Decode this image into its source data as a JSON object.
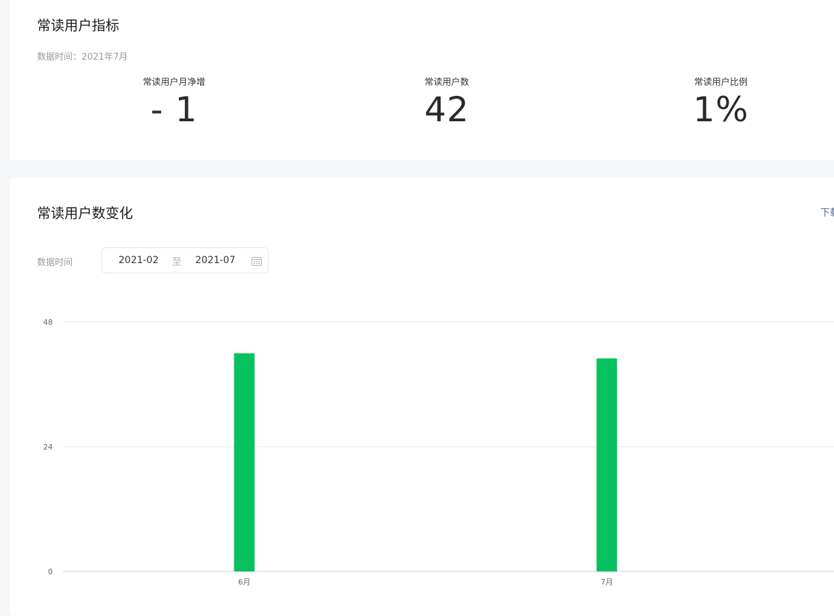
{
  "summary": {
    "title": "常读用户指标",
    "data_time": "数据时间：2021年7月",
    "metrics": [
      {
        "label": "常读用户月净增",
        "value": "- 1"
      },
      {
        "label": "常读用户数",
        "value": "42"
      },
      {
        "label": "常读用户比例",
        "value": "1%"
      }
    ]
  },
  "trend": {
    "title": "常读用户数变化",
    "download_label": "下载",
    "filter_label": "数据时间",
    "date_start": "2021-02",
    "date_sep": "至",
    "date_end": "2021-07",
    "calendar_icon": "calendar-icon"
  },
  "colors": {
    "bar": "#07c160",
    "grid": "#e6e6e6",
    "link": "#576b95"
  },
  "chart_data": {
    "type": "bar",
    "categories": [
      "6月",
      "7月"
    ],
    "values": [
      42,
      41
    ],
    "ylim": [
      0,
      48
    ],
    "yticks": [
      "0",
      "24",
      "48"
    ],
    "grid": true
  }
}
